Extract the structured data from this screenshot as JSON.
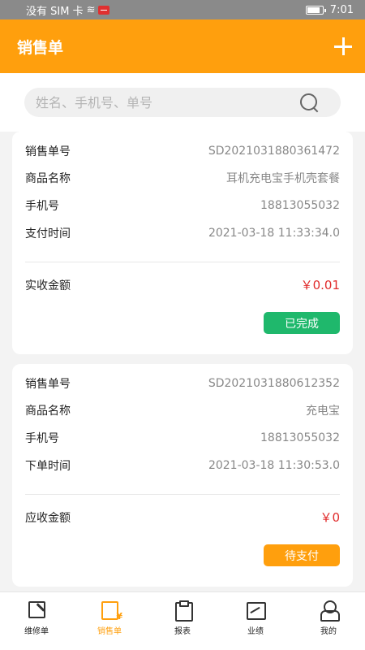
{
  "status_bar": {
    "carrier": "没有 SIM 卡",
    "time": "7:01"
  },
  "header": {
    "title": "销售单"
  },
  "search": {
    "placeholder": "姓名、手机号、单号"
  },
  "orders": [
    {
      "order_no_label": "销售单号",
      "order_no": "SD2021031880361472",
      "product_label": "商品名称",
      "product": "耳机充电宝手机壳套餐",
      "phone_label": "手机号",
      "phone": "18813055032",
      "time_label": "支付时间",
      "time": "2021-03-18 11:33:34.0",
      "amount_label": "实收金额",
      "amount": "￥0.01",
      "status": "已完成"
    },
    {
      "order_no_label": "销售单号",
      "order_no": "SD2021031880612352",
      "product_label": "商品名称",
      "product": "充电宝",
      "phone_label": "手机号",
      "phone": "18813055032",
      "time_label": "下单时间",
      "time": "2021-03-18 11:30:53.0",
      "amount_label": "应收金额",
      "amount": "￥0",
      "status": "待支付"
    }
  ],
  "nav": [
    {
      "label": "维修单",
      "icon": "repair-order-icon"
    },
    {
      "label": "销售单",
      "icon": "sales-order-icon"
    },
    {
      "label": "报表",
      "icon": "report-icon"
    },
    {
      "label": "业绩",
      "icon": "performance-icon"
    },
    {
      "label": "我的",
      "icon": "user-icon"
    }
  ],
  "colors": {
    "brand": "#ff9f0d",
    "done": "#1fb86c",
    "amount": "#e02b2b"
  }
}
